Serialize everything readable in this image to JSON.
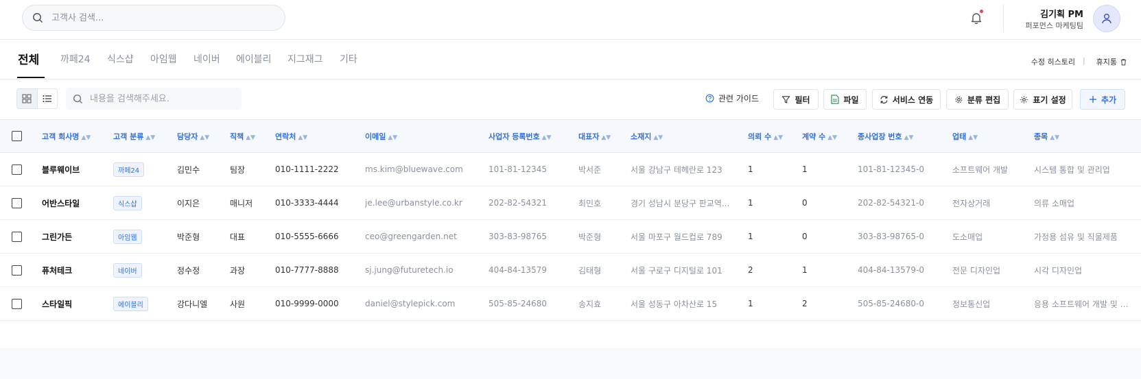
{
  "header": {
    "search_placeholder": "고객사 검색...",
    "user_name": "김기획 PM",
    "user_team": "퍼포먼스 마케팅팀"
  },
  "tabs": [
    {
      "label": "전체",
      "active": true
    },
    {
      "label": "까페24"
    },
    {
      "label": "식스샵"
    },
    {
      "label": "아임웹"
    },
    {
      "label": "네이버"
    },
    {
      "label": "에이블리"
    },
    {
      "label": "지그재그"
    },
    {
      "label": "기타"
    }
  ],
  "tab_links": {
    "history": "수정 히스토리",
    "separator": "|",
    "trash": "휴지통"
  },
  "toolbar": {
    "search_placeholder": "내용을 검색해주세요.",
    "guide": "관련 가이드",
    "filter": "필터",
    "file": "파일",
    "service_link": "서비스 연동",
    "category_edit": "분류 편집",
    "display_settings": "표기 설정",
    "add": "추가"
  },
  "table": {
    "columns": [
      "고객 회사명",
      "고객 분류",
      "담당자",
      "직책",
      "연락처",
      "이메일",
      "사업자 등록번호",
      "대표자",
      "소재지",
      "의뢰 수",
      "계약 수",
      "종사업장 번호",
      "업태",
      "종목"
    ],
    "rows": [
      [
        "블루웨이브",
        "까페24",
        "김민수",
        "팀장",
        "010-1111-2222",
        "ms.kim@bluewave.com",
        "101-81-12345",
        "박서준",
        "서울 강남구 테헤란로 123",
        "1",
        "1",
        "101-81-12345-0",
        "소프트웨어 개발",
        "시스템 통합 및 관리업"
      ],
      [
        "어반스타일",
        "식스샵",
        "이지은",
        "매니저",
        "010-3333-4444",
        "je.lee@urbanstyle.co.kr",
        "202-82-54321",
        "최민호",
        "경기 성남시 분당구 판교역...",
        "1",
        "0",
        "202-82-54321-0",
        "전자상거래",
        "의류 소매업"
      ],
      [
        "그린가든",
        "아임웹",
        "박준형",
        "대표",
        "010-5555-6666",
        "ceo@greengarden.net",
        "303-83-98765",
        "박준형",
        "서울 마포구 월드컵로 789",
        "1",
        "0",
        "303-83-98765-0",
        "도소매업",
        "가정용 섬유 및 직물제품"
      ],
      [
        "퓨처테크",
        "네이버",
        "정수정",
        "과장",
        "010-7777-8888",
        "sj.jung@futuretech.io",
        "404-84-13579",
        "김태형",
        "서울 구로구 디지털로 101",
        "2",
        "1",
        "404-84-13579-0",
        "전문 디자인업",
        "시각 디자인업"
      ],
      [
        "스타일픽",
        "에이블리",
        "강다니엘",
        "사원",
        "010-9999-0000",
        "daniel@stylepick.com",
        "505-85-24680",
        "송지효",
        "서울 성동구 아차산로 15",
        "1",
        "2",
        "505-85-24680-0",
        "정보통신업",
        "응용 소프트웨어 개발 및 공..."
      ]
    ]
  },
  "colors": {
    "accent": "#2f6fe4",
    "notification": "#e5484d"
  }
}
